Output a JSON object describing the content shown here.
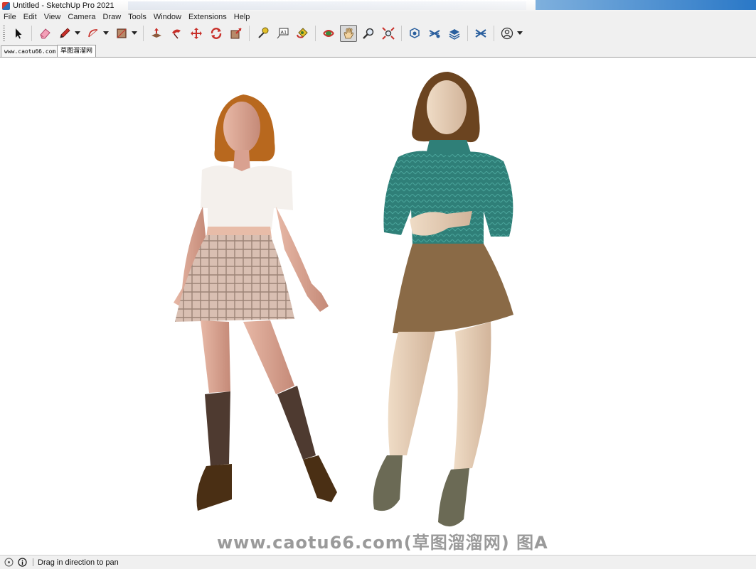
{
  "window": {
    "title": "Untitled - SketchUp Pro 2021"
  },
  "menu": [
    "File",
    "Edit",
    "View",
    "Camera",
    "Draw",
    "Tools",
    "Window",
    "Extensions",
    "Help"
  ],
  "toolbar": {
    "tools": [
      {
        "icon": "select-arrow-icon"
      },
      {
        "icon": "eraser-icon"
      },
      {
        "icon": "pencil-line-icon"
      },
      {
        "icon": "arc-icon"
      },
      {
        "icon": "rectangle-shape-icon"
      },
      {
        "icon": "push-pull-icon"
      },
      {
        "icon": "follow-me-icon"
      },
      {
        "icon": "move-icon"
      },
      {
        "icon": "rotate-icon"
      },
      {
        "icon": "scale-icon"
      },
      {
        "icon": "tape-measure-icon"
      },
      {
        "icon": "text-label-icon"
      },
      {
        "icon": "paint-bucket-icon"
      },
      {
        "icon": "orbit-icon"
      },
      {
        "icon": "pan-hand-icon",
        "active": true
      },
      {
        "icon": "zoom-icon"
      },
      {
        "icon": "zoom-extents-icon"
      },
      {
        "icon": "warehouse-icon"
      },
      {
        "icon": "extension-warehouse-icon"
      },
      {
        "icon": "layout-icon"
      },
      {
        "icon": "extension-manager-icon"
      },
      {
        "icon": "user-account-icon"
      }
    ],
    "text_label_glyph": "A1"
  },
  "scenes": [
    "www.caotu66.com",
    "草图溜溜网"
  ],
  "viewport": {
    "watermark": "www.caotu66.com(草图溜溜网) 图A"
  },
  "status": {
    "message": "Drag in direction to pan"
  },
  "colors": {
    "accent_red": "#d63b2f",
    "accent_blue": "#2a6fb8",
    "chrome_bg": "#f0f0f0"
  }
}
